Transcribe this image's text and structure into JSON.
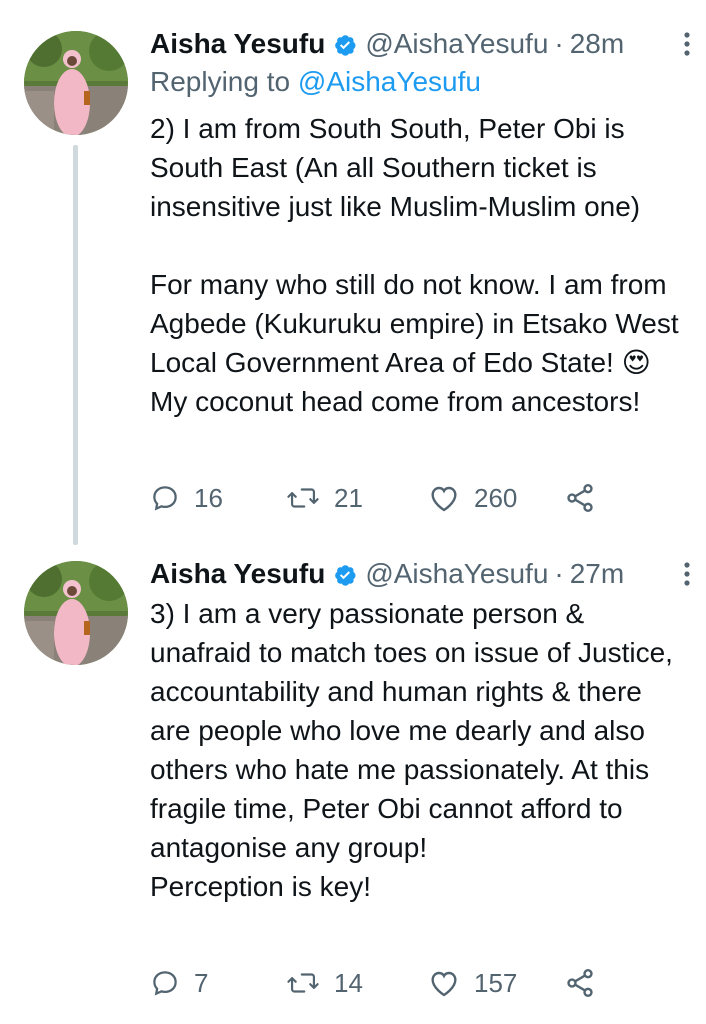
{
  "tweets": [
    {
      "author_name": "Aisha Yesufu",
      "handle": "@AishaYesufu",
      "separator": "·",
      "time": "28m",
      "replying_prefix": "Replying to ",
      "replying_handle": "@AishaYesufu",
      "text": "2) I am from South South, Peter Obi is South East (An all Southern ticket is insensitive just like Muslim-Muslim one)\n\nFor many who still do not know. I am from Agbede (Kukuruku empire) in Etsako West Local Government Area of Edo State! 😍\nMy coconut head come from ancestors!",
      "replies": "16",
      "retweets": "21",
      "likes": "260"
    },
    {
      "author_name": "Aisha Yesufu",
      "handle": "@AishaYesufu",
      "separator": "·",
      "time": "27m",
      "text": "3) I am a very passionate person & unafraid to match toes on issue of Justice, accountability and human rights & there are people who love me dearly and also others who hate me passionately. At this fragile time, Peter Obi cannot afford to antagonise any group!\nPerception is key!",
      "replies": "7",
      "retweets": "14",
      "likes": "157"
    }
  ],
  "icons": {
    "verified": "verified-badge-icon",
    "more": "more-vertical-icon",
    "reply": "reply-icon",
    "retweet": "retweet-icon",
    "like": "heart-icon",
    "share": "share-icon"
  },
  "colors": {
    "accent": "#1d9bf0",
    "secondary_text": "#536471",
    "thread_line": "#cfd9de"
  }
}
